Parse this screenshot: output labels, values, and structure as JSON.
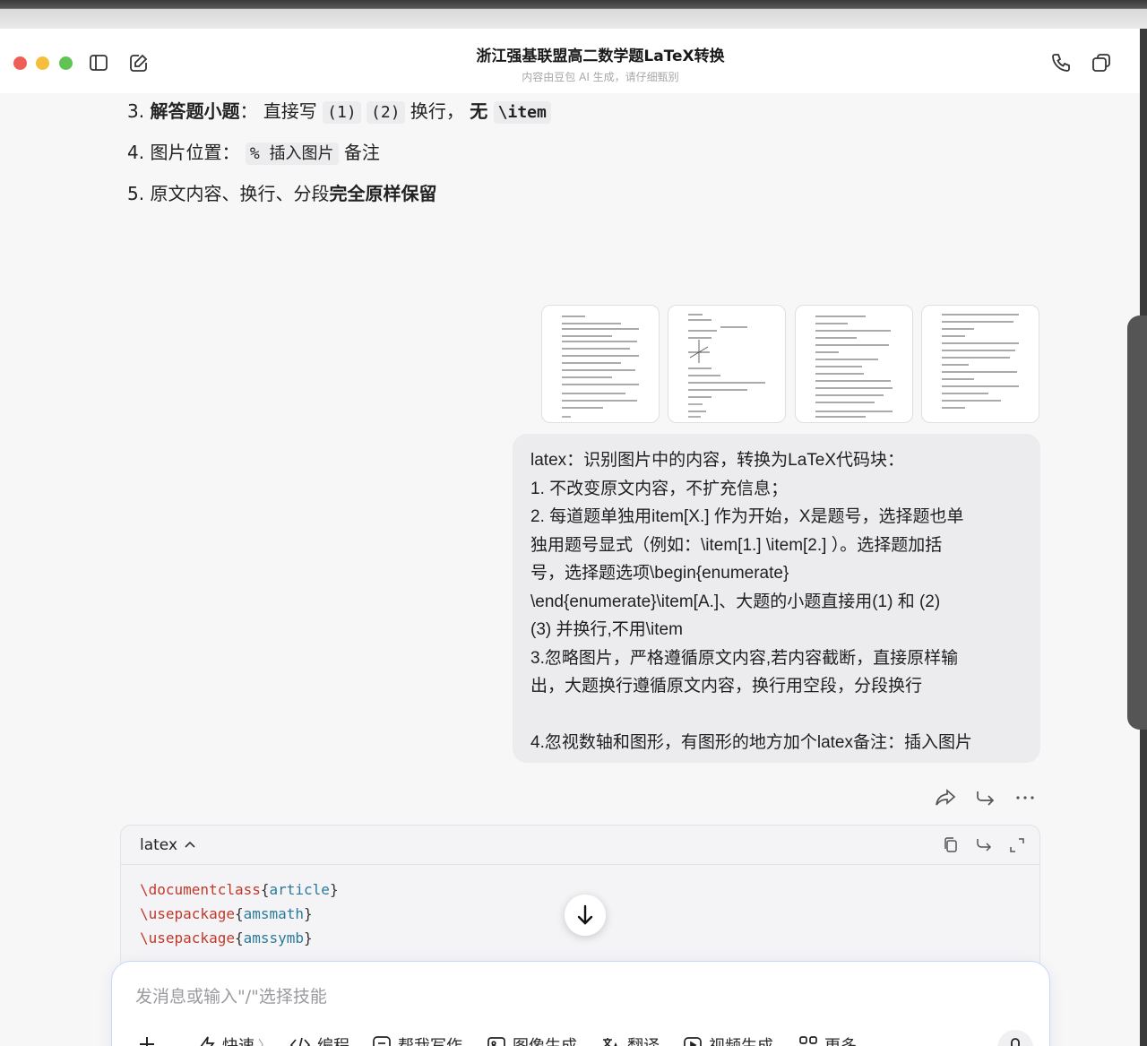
{
  "window": {
    "title": "浙江强基联盟高二数学题LaTeX转换",
    "subtitle": "内容由豆包 AI 生成，请仔细甄别"
  },
  "assistant_list": {
    "item3": {
      "num": "3.",
      "label": "解答题小题",
      "colon": "：",
      "text1": "直接写",
      "code1": "(1)",
      "code2": "(2)",
      "text2": "换行，",
      "bold2": "无",
      "code3": "\\item"
    },
    "item4": {
      "num": "4.",
      "text1": "图片位置：",
      "code1": "% 插入图片",
      "text2": "备注"
    },
    "item5": {
      "num": "5.",
      "text1": "原文内容、换行、分段",
      "bold": "完全原样保留"
    }
  },
  "user_message": {
    "lines": [
      "latex：识别图片中的内容，转换为LaTeX代码块：",
      "1. 不改变原文内容，不扩充信息；",
      "2. 每道题单独用item[X.] 作为开始，X是题号，选择题也单",
      "独用题号显式（例如：\\item[1.] \\item[2.] ）。选择题加括",
      "号，选择题选项\\begin{enumerate}",
      "\\end{enumerate}\\item[A.]、大题的小题直接用(1) 和  (2)",
      "(3) 并换行,不用\\item",
      "3.忽略图片，严格遵循原文内容,若内容截断，直接原样输",
      "出，大题换行遵循原文内容，换行用空段，分段换行",
      "",
      "4.忽视数轴和图形，有图形的地方加个latex备注：插入图片"
    ]
  },
  "code_block": {
    "language": "latex",
    "lines": [
      {
        "cmd": "\\documentclass",
        "arg": "article"
      },
      {
        "cmd": "\\usepackage",
        "arg": "amsmath"
      },
      {
        "cmd": "\\usepackage",
        "arg": "amssymb"
      }
    ]
  },
  "composer": {
    "placeholder": "发消息或输入\"/\"选择技能",
    "tools": {
      "quick": "快速",
      "code": "编程",
      "write": "帮我写作",
      "image": "图像生成",
      "translate": "翻译",
      "video": "视频生成",
      "more": "更多"
    }
  }
}
